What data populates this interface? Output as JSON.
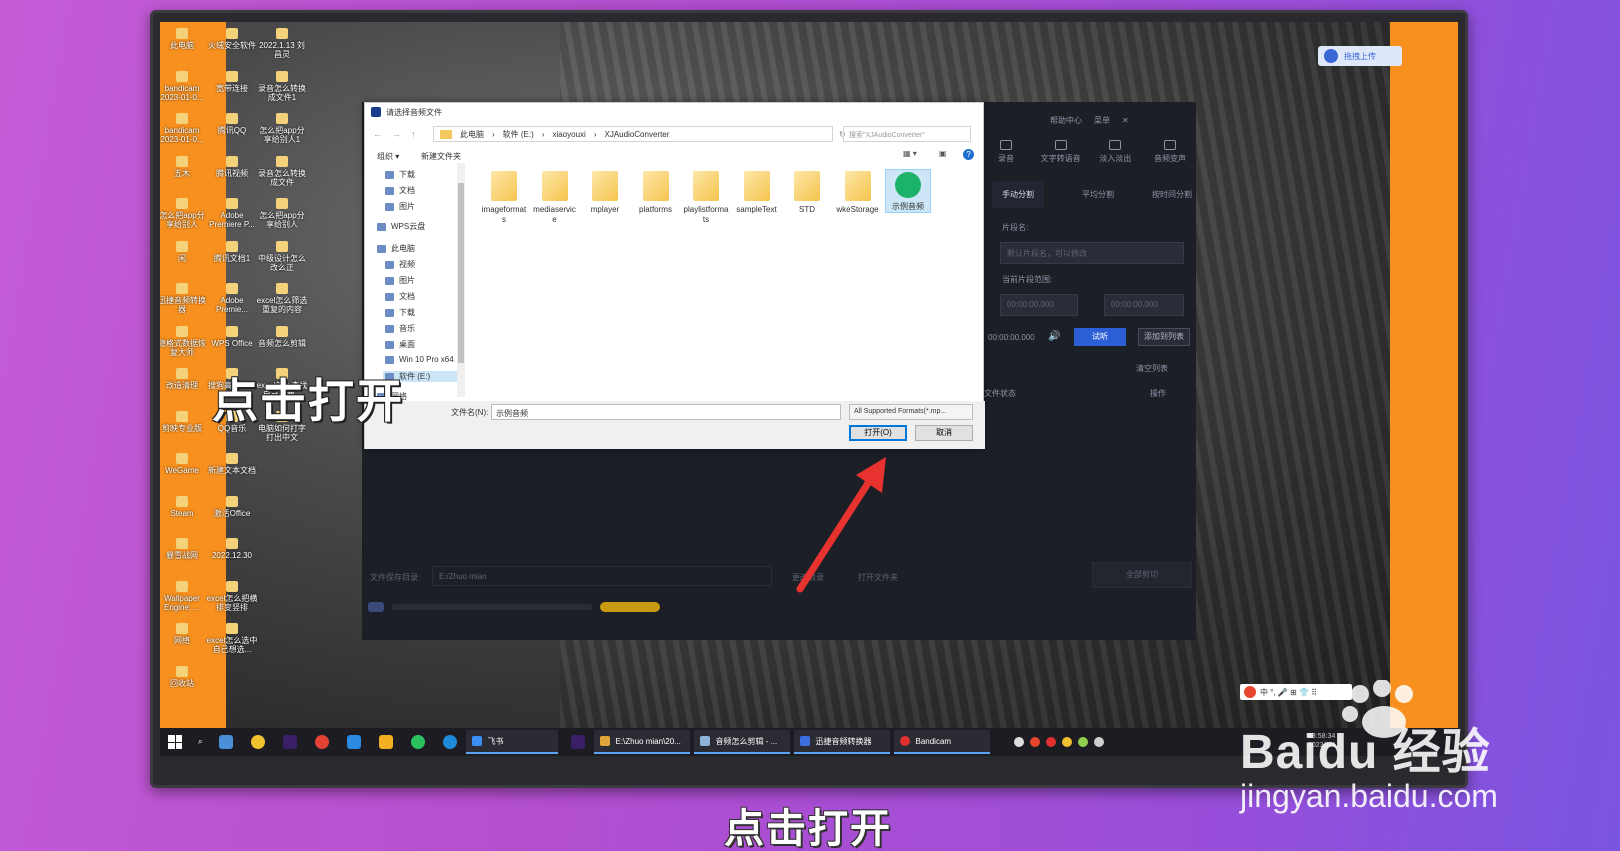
{
  "desktop": {
    "icons_col1": [
      "此电脑",
      "bandicam 2023-01-0...",
      "bandicam 2023-01-0...",
      "五木",
      "怎么把app分享给别人",
      "闲",
      "迅捷音频转换器",
      "隐格式数据恢复大师",
      "改造清理",
      "剪映专业版",
      "WeGame",
      "Steam",
      "暴雪战网",
      "Wallpaper Engine: ...",
      "网络",
      "回收站"
    ],
    "icons_col2": [
      "火绒安全软件",
      "宽带连接",
      "腾讯QQ",
      "腾讯视频",
      "Adobe Premiere P...",
      "腾讯文档1",
      "Adobe Premie...",
      "WPS Office",
      "搜狗高速浏览器",
      "QQ音乐",
      "新建文本文档",
      "激活Office",
      "2022.12.30",
      "excel怎么把横排变竖排",
      "excel怎么选中自己想选..."
    ],
    "icons_col3": [
      "2022.1.13 刘昌灵",
      "录音怎么转换成文件1",
      "怎么把app分享给别人1",
      "录音怎么转换成文件",
      "怎么把app分享给别人",
      "中级设计怎么改么正",
      "excel怎么筛选重复的内容",
      "音频怎么剪辑",
      "excel怎么查找自己想要...",
      "电脑如何打字打出中文"
    ]
  },
  "cloud_button": {
    "label": "拖拽上传"
  },
  "app": {
    "top_items": [
      "帮助中心",
      "菜单"
    ],
    "tabs": [
      "录音",
      "文字转语音",
      "淡入淡出",
      "音频变声"
    ],
    "subtabs": [
      "手动分割",
      "平均分割",
      "按时间分割"
    ],
    "segment_name_label": "片段名:",
    "segment_name_placeholder": "默认片段名，可以修改",
    "range_label": "当前片段范围:",
    "range_start": "00:00:00.000",
    "range_end": "00:00:00.000",
    "play_time": "00:00:00.000",
    "try_button": "试听",
    "add_button": "添加到列表",
    "clear_list": "清空列表",
    "col_status": "文件状态",
    "col_action": "操作",
    "save_dir_label": "文件保存目录:",
    "save_dir_value": "E:/Zhuo mian",
    "change_dir": "更改目录",
    "open_folder": "打开文件夹",
    "cut_all": "全部剪切"
  },
  "dialog": {
    "title": "请选择音频文件",
    "breadcrumb": [
      "此电脑",
      "软件 (E:)",
      "xiaoyouxi",
      "XJAudioConverter"
    ],
    "search_placeholder": "搜索\"XJAudioConverter\"",
    "toolbar_organize": "组织 ▾",
    "toolbar_new_folder": "新建文件夹",
    "sidebar": [
      "下载",
      "文档",
      "图片",
      "WPS云盘",
      "此电脑",
      "视频",
      "图片",
      "文档",
      "下载",
      "音乐",
      "桌面",
      "Win 10 Pro x64",
      "软件 (E:)",
      "网络"
    ],
    "files": [
      {
        "name": "imageformats"
      },
      {
        "name": "mediaservice"
      },
      {
        "name": "mplayer"
      },
      {
        "name": "platforms"
      },
      {
        "name": "playlistformats"
      },
      {
        "name": "sampleText"
      },
      {
        "name": "STD"
      },
      {
        "name": "wkeStorage"
      },
      {
        "name": "示例音频"
      }
    ],
    "filename_label": "文件名(N):",
    "filename_value": "示例音频",
    "filter_value": "All Supported Formats(*.mp...",
    "open_button": "打开(O)",
    "cancel_button": "取消"
  },
  "taskbar": {
    "tasks": [
      "飞书",
      "E:\\Zhuo mian\\20...",
      "音频怎么剪辑 - ...",
      "迅捷音频转换器",
      "Bandicam"
    ],
    "tray_time": "13:58:34",
    "tray_date": "2023/1/4"
  },
  "captions": {
    "overlay": "点击打开",
    "bottom": "点击打开"
  },
  "watermark": {
    "brand": "Baidu 经验",
    "url": "jingyan.baidu.com"
  },
  "ime": {
    "label": "中 °, 🎤 ⊞ 👕 ⠿"
  }
}
